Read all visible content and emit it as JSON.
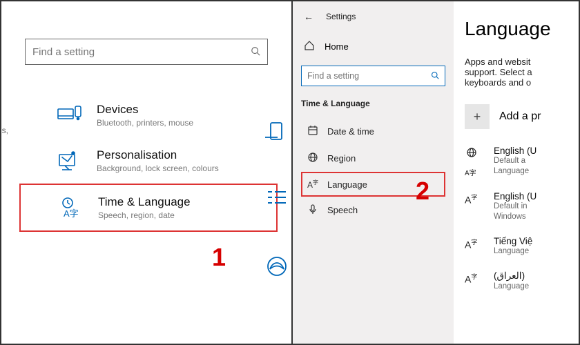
{
  "left": {
    "search_placeholder": "Find a setting",
    "cut_text": "ns,",
    "categories": [
      {
        "title": "Devices",
        "sub": "Bluetooth, printers, mouse"
      },
      {
        "title": "Personalisation",
        "sub": "Background, lock screen, colours"
      },
      {
        "title": "Time & Language",
        "sub": "Speech, region, date"
      }
    ],
    "marker1": "1"
  },
  "right": {
    "top_back": "←",
    "top_title": "Settings",
    "home": "Home",
    "search_placeholder": "Find a setting",
    "section": "Time & Language",
    "items": [
      {
        "icon": "date",
        "label": "Date & time"
      },
      {
        "icon": "region",
        "label": "Region"
      },
      {
        "icon": "language",
        "label": "Language"
      },
      {
        "icon": "speech",
        "label": "Speech"
      }
    ],
    "marker2": "2",
    "content": {
      "heading": "Language",
      "desc_l1": "Apps and websit",
      "desc_l2": "support. Select a",
      "desc_l3": "keyboards and o",
      "add_label": "Add a pr",
      "langs": [
        {
          "title": "English (U",
          "sub1": "Default a",
          "sub2": "Language"
        },
        {
          "title": "English (U",
          "sub1": "Default in",
          "sub2": "Windows"
        },
        {
          "title": "Tiếng Việ",
          "sub1": "Language",
          "sub2": ""
        },
        {
          "title": "(العراق)",
          "sub1": "Language",
          "sub2": ""
        }
      ]
    }
  }
}
